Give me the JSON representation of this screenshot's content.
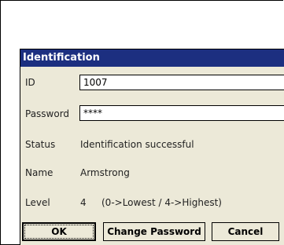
{
  "dialog": {
    "title": "Identification"
  },
  "fields": {
    "id_label": "ID",
    "id_value": "1007",
    "password_label": "Password",
    "password_value": "****"
  },
  "info": {
    "status_label": "Status",
    "status_value": "Identification successful",
    "name_label": "Name",
    "name_value": "Armstrong",
    "level_label": "Level",
    "level_value": "4",
    "level_hint": "(0->Lowest / 4->Highest)"
  },
  "buttons": {
    "ok": "OK",
    "change_password": "Change Password",
    "cancel": "Cancel"
  },
  "colors": {
    "titlebar": "#1c2f80",
    "dialog_bg": "#ece9d8"
  }
}
